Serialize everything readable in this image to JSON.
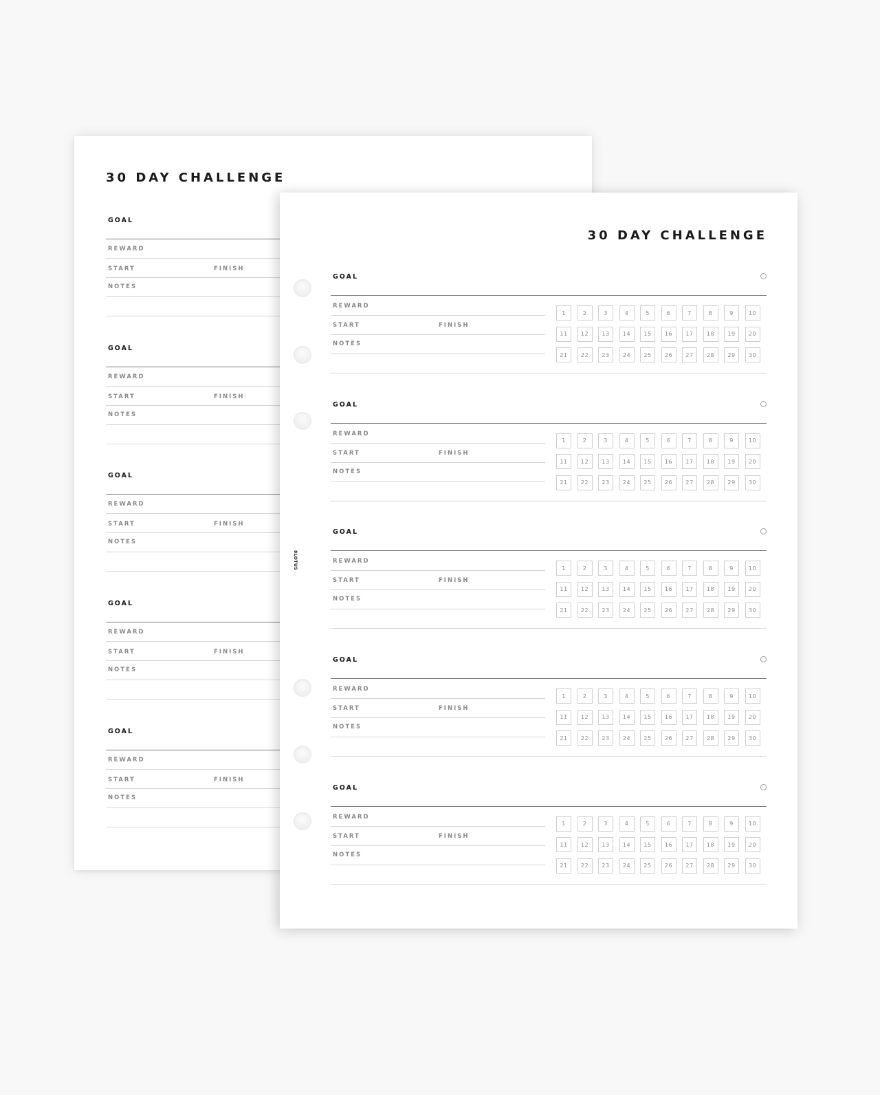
{
  "colors": {
    "background": "#f8f8f8",
    "paper": "#ffffff",
    "title_text": "#1a1a1a",
    "label_text": "#8a8a8a",
    "rule_light": "#d6d6d6",
    "rule_dark": "#7a7a7a",
    "box_border": "#cfcfcf"
  },
  "back_page": {
    "title": "30 DAY CHALLENGE",
    "sections": [
      {
        "goal": "GOAL",
        "reward": "REWARD",
        "start": "START",
        "finish": "FINISH",
        "notes": "NOTES"
      },
      {
        "goal": "GOAL",
        "reward": "REWARD",
        "start": "START",
        "finish": "FINISH",
        "notes": "NOTES"
      },
      {
        "goal": "GOAL",
        "reward": "REWARD",
        "start": "START",
        "finish": "FINISH",
        "notes": "NOTES"
      },
      {
        "goal": "GOAL",
        "reward": "REWARD",
        "start": "START",
        "finish": "FINISH",
        "notes": "NOTES"
      },
      {
        "goal": "GOAL",
        "reward": "REWARD",
        "start": "START",
        "finish": "FINISH",
        "notes": "NOTES"
      }
    ]
  },
  "front_page": {
    "title": "30 DAY CHALLENGE",
    "brand": "8LOTUS",
    "sections": [
      {
        "goal": "GOAL",
        "reward": "REWARD",
        "start": "START",
        "finish": "FINISH",
        "notes": "NOTES",
        "completed": false
      },
      {
        "goal": "GOAL",
        "reward": "REWARD",
        "start": "START",
        "finish": "FINISH",
        "notes": "NOTES",
        "completed": false
      },
      {
        "goal": "GOAL",
        "reward": "REWARD",
        "start": "START",
        "finish": "FINISH",
        "notes": "NOTES",
        "completed": false
      },
      {
        "goal": "GOAL",
        "reward": "REWARD",
        "start": "START",
        "finish": "FINISH",
        "notes": "NOTES",
        "completed": false
      },
      {
        "goal": "GOAL",
        "reward": "REWARD",
        "start": "START",
        "finish": "FINISH",
        "notes": "NOTES",
        "completed": false
      }
    ],
    "days": [
      "1",
      "2",
      "3",
      "4",
      "5",
      "6",
      "7",
      "8",
      "9",
      "10",
      "11",
      "12",
      "13",
      "14",
      "15",
      "16",
      "17",
      "18",
      "19",
      "20",
      "21",
      "22",
      "23",
      "24",
      "25",
      "26",
      "27",
      "28",
      "29",
      "30"
    ]
  }
}
